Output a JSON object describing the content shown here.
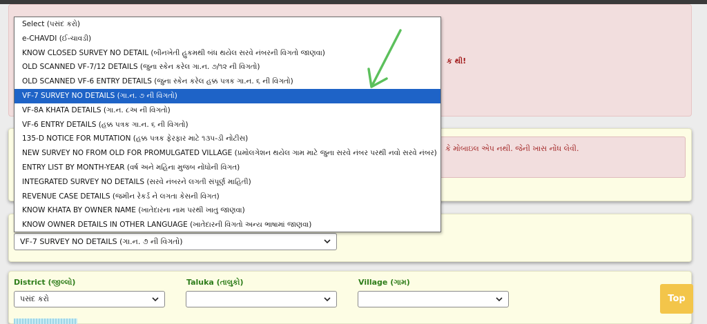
{
  "dropdown": {
    "selected_index": 5,
    "options": [
      "Select (પસંદ કરો)",
      "e-CHAVDI (ઈ-ચાવડી)",
      "KNOW CLOSED SURVEY NO DETAIL (બીનખેતી હુકમથી બંધ થયેલ સરવે નંબરની વિગતો જાણવા)",
      "OLD SCANNED VF-7/12 DETAILS (જુના સ્કેન કરેલ ગા.ન. ૭/૧૨ ની વિગતો)",
      "OLD SCANNED VF-6 ENTRY DETAILS (જુના સ્કેન કરેલ હક્ક પત્રક ગા.ન. ૬ ની વિગતો)",
      "VF-7 SURVEY NO DETAILS (ગા.ન. ૭ ની વિગતો)",
      "VF-8A KHATA DETAILS (ગા.ન. ૮અ ની વિગતો)",
      "VF-6 ENTRY DETAILS (હક્ક પત્રક ગા.ન. ૬ ની વિગતો)",
      "135-D NOTICE FOR MUTATION (હક્ક પત્રક ફેરફાર માટે ૧૩૫-ડી નોટીસ)",
      "NEW SURVEY NO FROM OLD FOR PROMULGATED VILLAGE (પ્રમોલગેશન થયેલ ગામ માટે જુના સરવે નંબર પરથી નવો સરવે નંબર)",
      "ENTRY LIST BY MONTH-YEAR (વર્ષ અને મહિના મુજબ નોંધોની વિગત)",
      "INTEGRATED SURVEY NO DETAILS (સરવે નંબરને લગતી સંપૂર્ણ માહિતી)",
      "REVENUE CASE DETAILS (જમીન રેકર્ડ ને લગતા કેસની વિગત)",
      "KNOW KHATA BY OWNER NAME (ખાતેદારના નામ પરથી ખાતુ જાણવા)",
      "KNOW OWNER DETAILS IN OTHER LANGUAGE (ખાતેદારની વિગતો અન્ય ભાષામાં જાણવા)"
    ]
  },
  "main_select": {
    "value": "VF-7 SURVEY NO DETAILS (ગા.ન. ૭ ની વિગતો)"
  },
  "pink_panel": {
    "tail_text": "ક થી!"
  },
  "notice": {
    "text": "કે મોબાઇલ એપ નથી. જેની ખાસ નોંધ લેવી."
  },
  "location": {
    "district_label": "District (જીલ્લો)",
    "district_value": "પસંદ કરો",
    "taluka_label": "Taluka (તાલુકો)",
    "taluka_value": "",
    "village_label": "Village (ગામ)",
    "village_value": ""
  },
  "top_button": {
    "label": "Top"
  },
  "colors": {
    "selection": "#1e63c7",
    "label_green": "#2e7d1a",
    "alert_red": "#a01818",
    "top_button": "#f3c54a",
    "arrow": "#5cc05c"
  }
}
